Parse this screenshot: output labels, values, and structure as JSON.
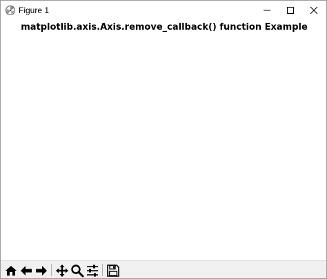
{
  "window": {
    "title": "Figure 1",
    "controls": {
      "minimize": "minimize",
      "maximize": "maximize",
      "close": "close"
    }
  },
  "figure": {
    "title": "matplotlib.axis.Axis.remove_callback() function Example"
  },
  "toolbar": {
    "tools": [
      "home",
      "back",
      "forward",
      "pan",
      "zoom",
      "configure-subplots",
      "save"
    ]
  }
}
